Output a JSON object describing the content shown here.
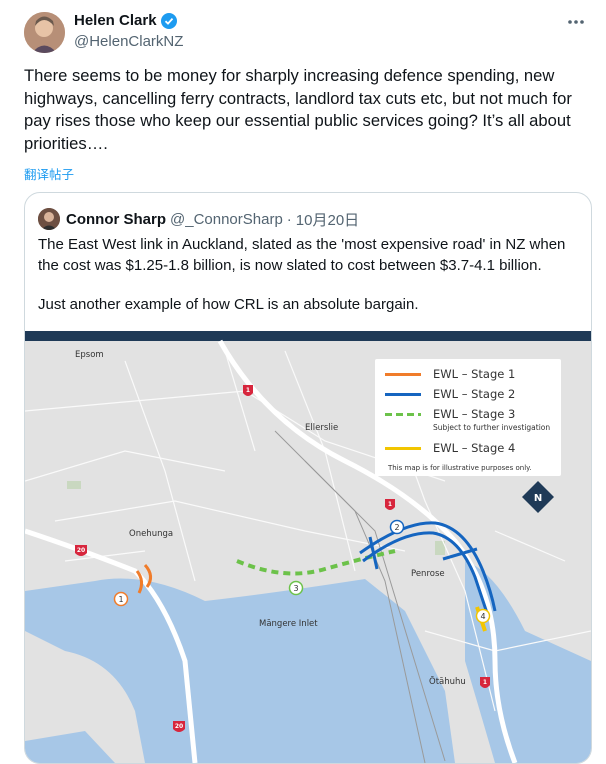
{
  "tweet": {
    "author": "Helen Clark",
    "handle": "@HelenClarkNZ",
    "text": "There seems to be money for sharply increasing defence spending, new highways, cancelling ferry contracts, landlord tax cuts etc,  but not much for pay rises those who keep our essential public services going? It’s all about priorities….",
    "translate": "翻译帖子"
  },
  "quote": {
    "author": "Connor Sharp",
    "handle": "@_ConnorSharp",
    "separator": "·",
    "date": "10月20日",
    "text1": "The East West link in Auckland, slated as the 'most expensive road' in NZ when the cost was $1.25-1.8 billion, is now slated to cost between $3.7-4.1 billion.",
    "text2": "Just another example of how CRL is an absolute bargain."
  },
  "map": {
    "legend": [
      {
        "label": "EWL – Stage 1",
        "color": "#f07c2a",
        "dashed": false
      },
      {
        "label": "EWL – Stage 2",
        "color": "#1565c0",
        "dashed": false
      },
      {
        "label": "EWL – Stage 3",
        "color": "#6cc24a",
        "dashed": true
      },
      {
        "label": "EWL – Stage 4",
        "color": "#f2c500",
        "dashed": false
      }
    ],
    "legend_subnote": "Subject to further investigation",
    "legend_note": "This map is for illustrative purposes only.",
    "places": {
      "epsom": "Epsom",
      "ellerslie": "Ellerslie",
      "onehunga": "Onehunga",
      "penrose": "Penrose",
      "mangere": "Māngere Inlet",
      "otahuhu": "Ōtāhuhu"
    },
    "north": "N",
    "markers": {
      "s1": "1",
      "s2": "2",
      "s3": "3",
      "s4": "4"
    },
    "road_shields": {
      "sh1": "1",
      "sh20": "20"
    }
  }
}
